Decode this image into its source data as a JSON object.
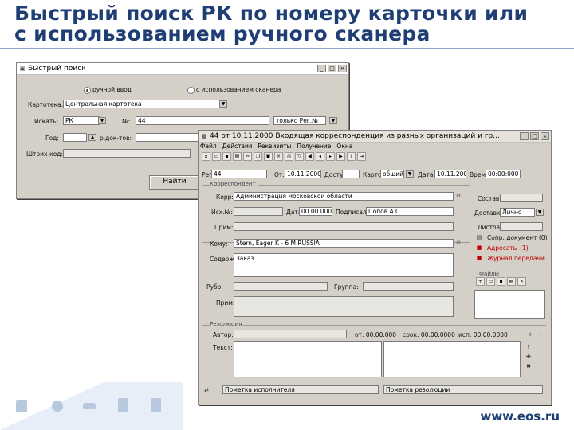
{
  "slide": {
    "title_line1": "Быстрый поиск РК по номеру карточки или",
    "title_line2": "с использованием ручного сканера",
    "website": "www.eos.ru"
  },
  "search_window": {
    "title": "Быстрый поиск",
    "radio_manual": "ручной ввод",
    "radio_scanner": "с использованием сканера",
    "cabinet_label": "Картотека:",
    "cabinet_value": "Центральная картотека",
    "search_label": "Искать:",
    "search_value": "РК",
    "number_label": "№:",
    "number_value": "44",
    "only_value": "только Рег.№",
    "year_label": "Год:",
    "doctype_label": "р.док-тов:",
    "barcode_label": "Штрих-код:",
    "find_button": "Найти"
  },
  "card_window": {
    "title": "44 от 10.11.2000 Входящая корреспонденция из разных организаций и гр...",
    "menu": [
      "Файл",
      "Действия",
      "Реквизиты",
      "Получение",
      "Окна"
    ],
    "toolbar_icons": [
      "new-icon",
      "open-icon",
      "save-icon",
      "print-icon",
      "cut-icon",
      "copy-icon",
      "paste-icon",
      "delete-icon",
      "find-icon",
      "filter-icon",
      "first-icon",
      "prev-icon",
      "next-icon",
      "last-icon",
      "help-icon",
      "exit-icon"
    ],
    "reg_num_label": "Рег.№:",
    "reg_num_value": "44",
    "from_label": "От:",
    "from_value": "10.11.2000",
    "access_label": "Доступ:",
    "access_value": "общий",
    "cabinet_label": "Картотека:",
    "time_label": "Время:",
    "time_value": "00:00:000",
    "date_value": "10.11.2000",
    "correspondent_section": "Корреспондент",
    "corr_label": "Корр:",
    "corr_value": "Администрация московской области",
    "out_num_label": "Исх.№:",
    "date_label": "Дата:",
    "date2_value": "00.00.0000",
    "signed_label": "Подписал:",
    "signed_value": "Попов А.С.",
    "note_label": "Прим:",
    "contents_label": "Кому:",
    "contents_value": "Stern, Eager K - 6 M RUSSIA",
    "summary_label": "Содерж:",
    "summary_value": "Заказ",
    "rubrics_label": "Рубр:",
    "group_label": "Группа:",
    "note2_label": "Прим:",
    "composition_label": "Состав:",
    "delivery_label": "Доставка:",
    "delivery_value": "Лично",
    "pages_label": "Листов:",
    "links": [
      "Сопр. документ (0)",
      "Адресаты (1)",
      "Журнал передачи"
    ],
    "files_label": "Файлы",
    "resolution_section": "Резолюция",
    "author_label": "Автор:",
    "res_from": "от: 00.00.000",
    "res_term": "срок: 00.00.0000",
    "res_done": "исп: 00.00.0000",
    "text_label": "Текст:",
    "status1": "Пометка исполнителя",
    "status2": "Пометка резолюции"
  }
}
